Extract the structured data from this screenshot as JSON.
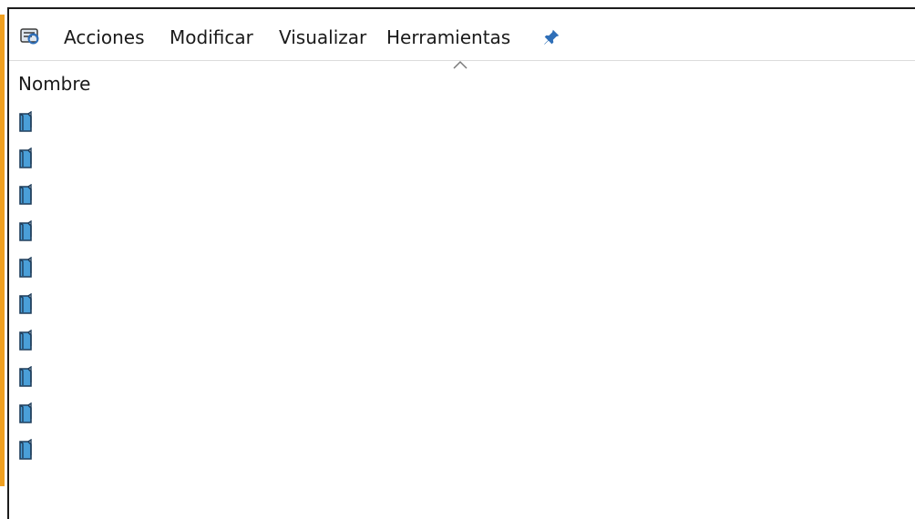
{
  "menubar": {
    "app_icon": "mmc-console-icon",
    "items": [
      {
        "label": "Acciones"
      },
      {
        "label": "Modificar"
      },
      {
        "label": "Visualizar"
      },
      {
        "label": "Herramientas"
      }
    ],
    "pin_icon": "pin-icon"
  },
  "list": {
    "column_header": "Nombre",
    "sort_indicator": "ascending",
    "rows": [
      {
        "icon": "book-icon",
        "label": ""
      },
      {
        "icon": "book-icon",
        "label": ""
      },
      {
        "icon": "book-icon",
        "label": ""
      },
      {
        "icon": "book-icon",
        "label": ""
      },
      {
        "icon": "book-icon",
        "label": ""
      },
      {
        "icon": "book-icon",
        "label": ""
      },
      {
        "icon": "book-icon",
        "label": ""
      },
      {
        "icon": "book-icon",
        "label": ""
      },
      {
        "icon": "book-icon",
        "label": ""
      },
      {
        "icon": "book-icon",
        "label": ""
      }
    ]
  },
  "colors": {
    "accent_bar": "#f0a020",
    "icon_blue": "#4a9fd8",
    "icon_dark": "#1f3d5a",
    "pin_blue": "#2f6fb8"
  }
}
